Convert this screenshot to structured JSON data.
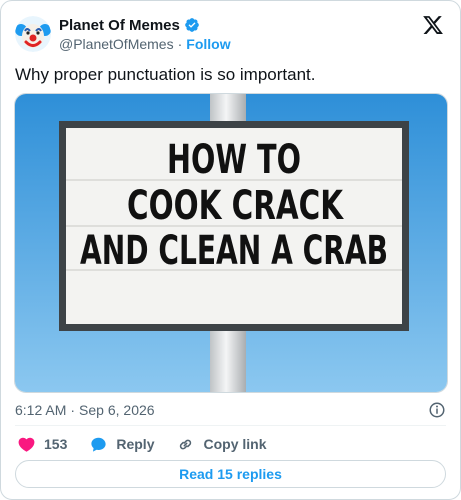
{
  "author": {
    "display_name": "Planet Of Memes",
    "handle": "@PlanetOfMemes",
    "separator": "·",
    "follow_label": "Follow",
    "avatar_icon": "clown-face-icon",
    "verified_color": "#1d9bf0"
  },
  "tweet": {
    "text": "Why proper punctuation is so important."
  },
  "media": {
    "sign_lines": [
      "HOW TO",
      "COOK CRACK",
      "AND CLEAN A CRAB"
    ]
  },
  "meta": {
    "time": "6:12 AM",
    "separator": "·",
    "date": "Sep 6, 2026"
  },
  "actions": {
    "like_count": "153",
    "reply_label": "Reply",
    "copy_link_label": "Copy link"
  },
  "footer": {
    "read_replies_label": "Read 15 replies"
  },
  "colors": {
    "accent": "#1d9bf0",
    "like": "#f91880",
    "sky": "#3fa3e6"
  }
}
